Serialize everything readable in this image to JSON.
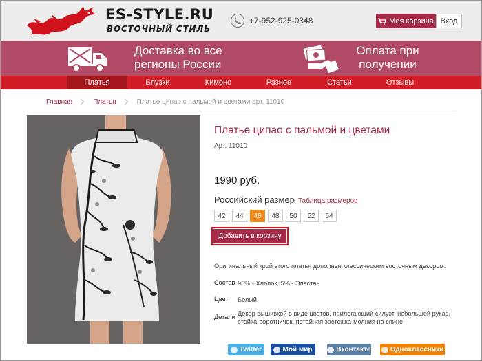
{
  "header": {
    "logo_title": "ES-STYLE.RU",
    "logo_subtitle": "ВОСТОЧНЫЙ СТИЛЬ",
    "phone": "+7-952-925-0348",
    "cart_label": "Моя корзина",
    "login_label": "Вход"
  },
  "banner": {
    "delivery_line1": "Доставка во все",
    "delivery_line2": "регионы России",
    "payment_line1": "Оплата при",
    "payment_line2": "получении"
  },
  "nav": {
    "items": [
      "Платья",
      "Блузки",
      "Кимоно",
      "Разное",
      "Статьи",
      "Отзывы"
    ],
    "active": "Платья"
  },
  "breadcrumb": {
    "home": "Главная",
    "category": "Платья",
    "current": "Платье ципао с пальмой и цветами арт. 11010"
  },
  "product": {
    "title": "Платье ципао с пальмой и цветами",
    "article": "Арт. 11010",
    "price": "1990 руб.",
    "size_label": "Российский размер",
    "size_table_link": "Таблица размеров",
    "sizes": [
      "42",
      "44",
      "46",
      "48",
      "50",
      "52",
      "54"
    ],
    "selected_size": "46",
    "add_to_cart": "Добавить в корзину",
    "description": "Оригинальный крой этого платья дополнен классическим восточным декором.",
    "specs": {
      "composition_label": "Состав",
      "composition_value": "95% - Хлопок, 5% - Эластан",
      "color_label": "Цвет",
      "color_value": "Белый",
      "details_label": "Детали",
      "details_line1": "Декор вышивкой в виде цветов, прилегающий силуэт, небольшой рукав,",
      "details_line2": "стойка-воротничок, потайная застежка-молния на спине"
    }
  },
  "social": {
    "twitter": "Twitter",
    "mymir": "Мой мир",
    "vk": "Вконтакте",
    "ok": "Одноклассники"
  },
  "colors": {
    "brand": "#a52a48",
    "banner": "#b14a66",
    "nav": "#d11e26",
    "selected_size": "#ee8a1a"
  }
}
